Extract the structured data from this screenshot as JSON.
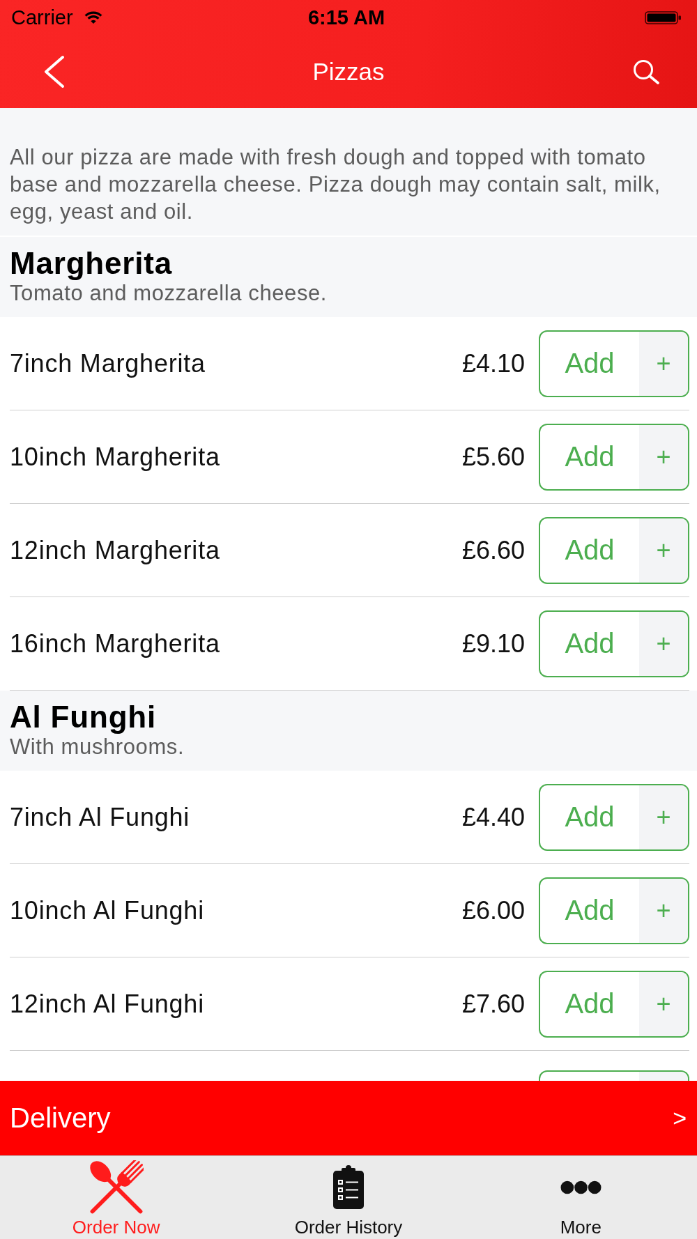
{
  "status_bar": {
    "carrier": "Carrier",
    "time": "6:15 AM"
  },
  "nav_bar": {
    "title": "Pizzas"
  },
  "intro": "All our pizza are made with fresh dough and topped with tomato base and mozzarella cheese. Pizza dough may contain salt, milk, egg, yeast and oil.",
  "sections": [
    {
      "title": "Margherita",
      "description": "Tomato and mozzarella cheese.",
      "items": [
        {
          "kind": "full",
          "name": "7inch Margherita",
          "price": "£4.10",
          "button": "Add",
          "plus": "+"
        },
        {
          "kind": "full",
          "name": "10inch Margherita",
          "price": "£5.60",
          "button": "Add",
          "plus": "+"
        },
        {
          "kind": "full",
          "name": "12inch Margherita",
          "price": "£6.60",
          "button": "Add",
          "plus": "+"
        },
        {
          "kind": "full",
          "name": "16inch Margherita",
          "price": "£9.10",
          "button": "Add",
          "plus": "+"
        }
      ]
    },
    {
      "title": "Al Funghi",
      "description": "With mushrooms.",
      "items": [
        {
          "kind": "full",
          "name": "7inch Al Funghi",
          "price": "£4.40",
          "button": "Add",
          "plus": "+"
        },
        {
          "kind": "full",
          "name": "10inch Al Funghi",
          "price": "£6.00",
          "button": "Add",
          "plus": "+"
        },
        {
          "kind": "full",
          "name": "12inch Al Funghi",
          "price": "£7.60",
          "button": "Add",
          "plus": "+"
        },
        {
          "kind": "cut"
        }
      ]
    }
  ],
  "delivery_bar": {
    "label": "Delivery",
    "arrow": ">"
  },
  "tab_bar": [
    {
      "label": "Order Now",
      "selected": true
    },
    {
      "label": "Order History",
      "selected": false
    },
    {
      "label": "More",
      "selected": false
    }
  ]
}
